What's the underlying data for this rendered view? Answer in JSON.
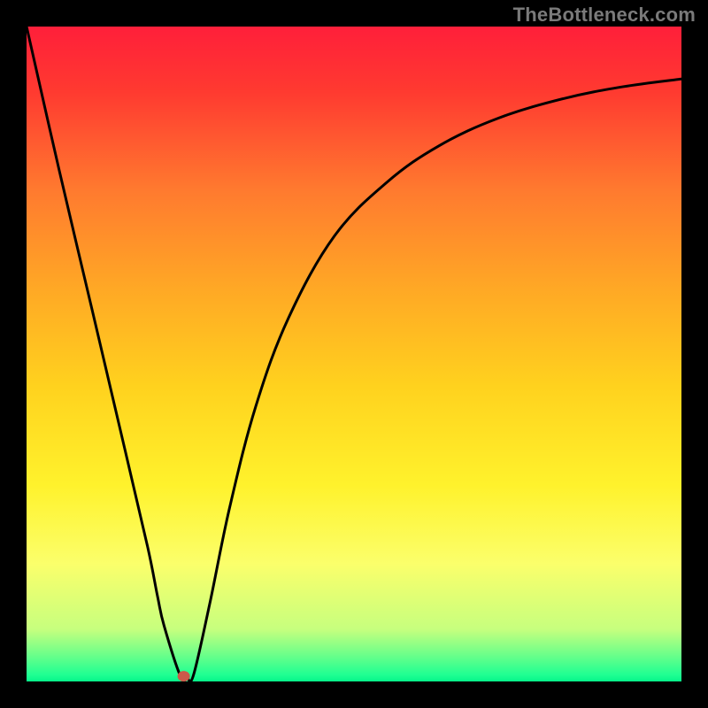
{
  "watermark": "TheBottleneck.com",
  "chart_data": {
    "type": "line",
    "title": "",
    "xlabel": "",
    "ylabel": "",
    "xlim": [
      0,
      100
    ],
    "ylim": [
      0,
      100
    ],
    "grid": false,
    "legend": false,
    "background": {
      "type": "vertical-gradient",
      "stops": [
        {
          "pct": 0,
          "color": "#ff1f3a"
        },
        {
          "pct": 10,
          "color": "#ff3a30"
        },
        {
          "pct": 25,
          "color": "#ff7a2f"
        },
        {
          "pct": 40,
          "color": "#ffa825"
        },
        {
          "pct": 55,
          "color": "#ffd21e"
        },
        {
          "pct": 70,
          "color": "#fff22c"
        },
        {
          "pct": 82,
          "color": "#fbff6b"
        },
        {
          "pct": 92,
          "color": "#c7ff7e"
        },
        {
          "pct": 96,
          "color": "#6aff8a"
        },
        {
          "pct": 99,
          "color": "#1fff92"
        },
        {
          "pct": 100,
          "color": "#06f58a"
        }
      ]
    },
    "series": [
      {
        "name": "bottleneck-curve",
        "color": "#000000",
        "stroke_width": 3,
        "x": [
          0.0,
          5.0,
          10.0,
          15.0,
          18.5,
          20.0,
          21.0,
          23.5,
          24.5,
          25.5,
          28.0,
          31.0,
          35.0,
          40.0,
          47.0,
          55.0,
          63.0,
          72.0,
          82.0,
          91.0,
          100.0
        ],
        "y": [
          100.0,
          78.0,
          56.8,
          35.5,
          20.5,
          13.0,
          8.5,
          0.8,
          0.5,
          1.0,
          12.0,
          26.5,
          42.0,
          55.5,
          68.0,
          76.2,
          81.8,
          86.0,
          89.0,
          90.8,
          92.0
        ]
      }
    ],
    "marker": {
      "name": "optimal-point",
      "x": 24.0,
      "y": 0.8,
      "color": "#cc5a4a",
      "rx": 7,
      "ry": 6
    }
  }
}
